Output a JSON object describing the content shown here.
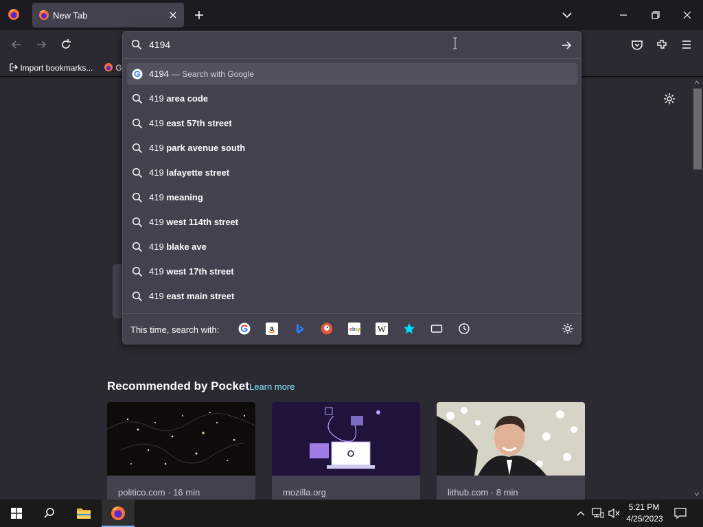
{
  "browser": {
    "tab": {
      "title": "New Tab"
    },
    "bookmarks": [
      {
        "label": "Import bookmarks..."
      },
      {
        "label": "G"
      }
    ]
  },
  "urlbar": {
    "value": "4194",
    "first_row": {
      "text": "4194",
      "action": "— Search with Google"
    },
    "suggestions": [
      {
        "prefix": "419",
        "bold": "area code"
      },
      {
        "prefix": "419",
        "bold": "east 57th street"
      },
      {
        "prefix": "419",
        "bold": "park avenue south"
      },
      {
        "prefix": "419",
        "bold": "lafayette street"
      },
      {
        "prefix": "419",
        "bold": "meaning"
      },
      {
        "prefix": "419",
        "bold": "west 114th street"
      },
      {
        "prefix": "419",
        "bold": "blake ave"
      },
      {
        "prefix": "419",
        "bold": "west 17th street"
      },
      {
        "prefix": "419",
        "bold": "east main street"
      }
    ],
    "one_off_label": "This time, search with:",
    "engines": [
      "google",
      "amazon",
      "bing",
      "duckduckgo",
      "ebay",
      "wikipedia",
      "bookmarks",
      "tabs",
      "history"
    ]
  },
  "pocket": {
    "heading": "Recommended by Pocket",
    "learn_more": "Learn more",
    "cards": [
      {
        "meta": "politico.com · 16 min"
      },
      {
        "meta": "mozilla.org"
      },
      {
        "meta": "lithub.com · 8 min"
      }
    ]
  },
  "taskbar": {
    "time": "5:21 PM",
    "date": "4/25/2023"
  }
}
